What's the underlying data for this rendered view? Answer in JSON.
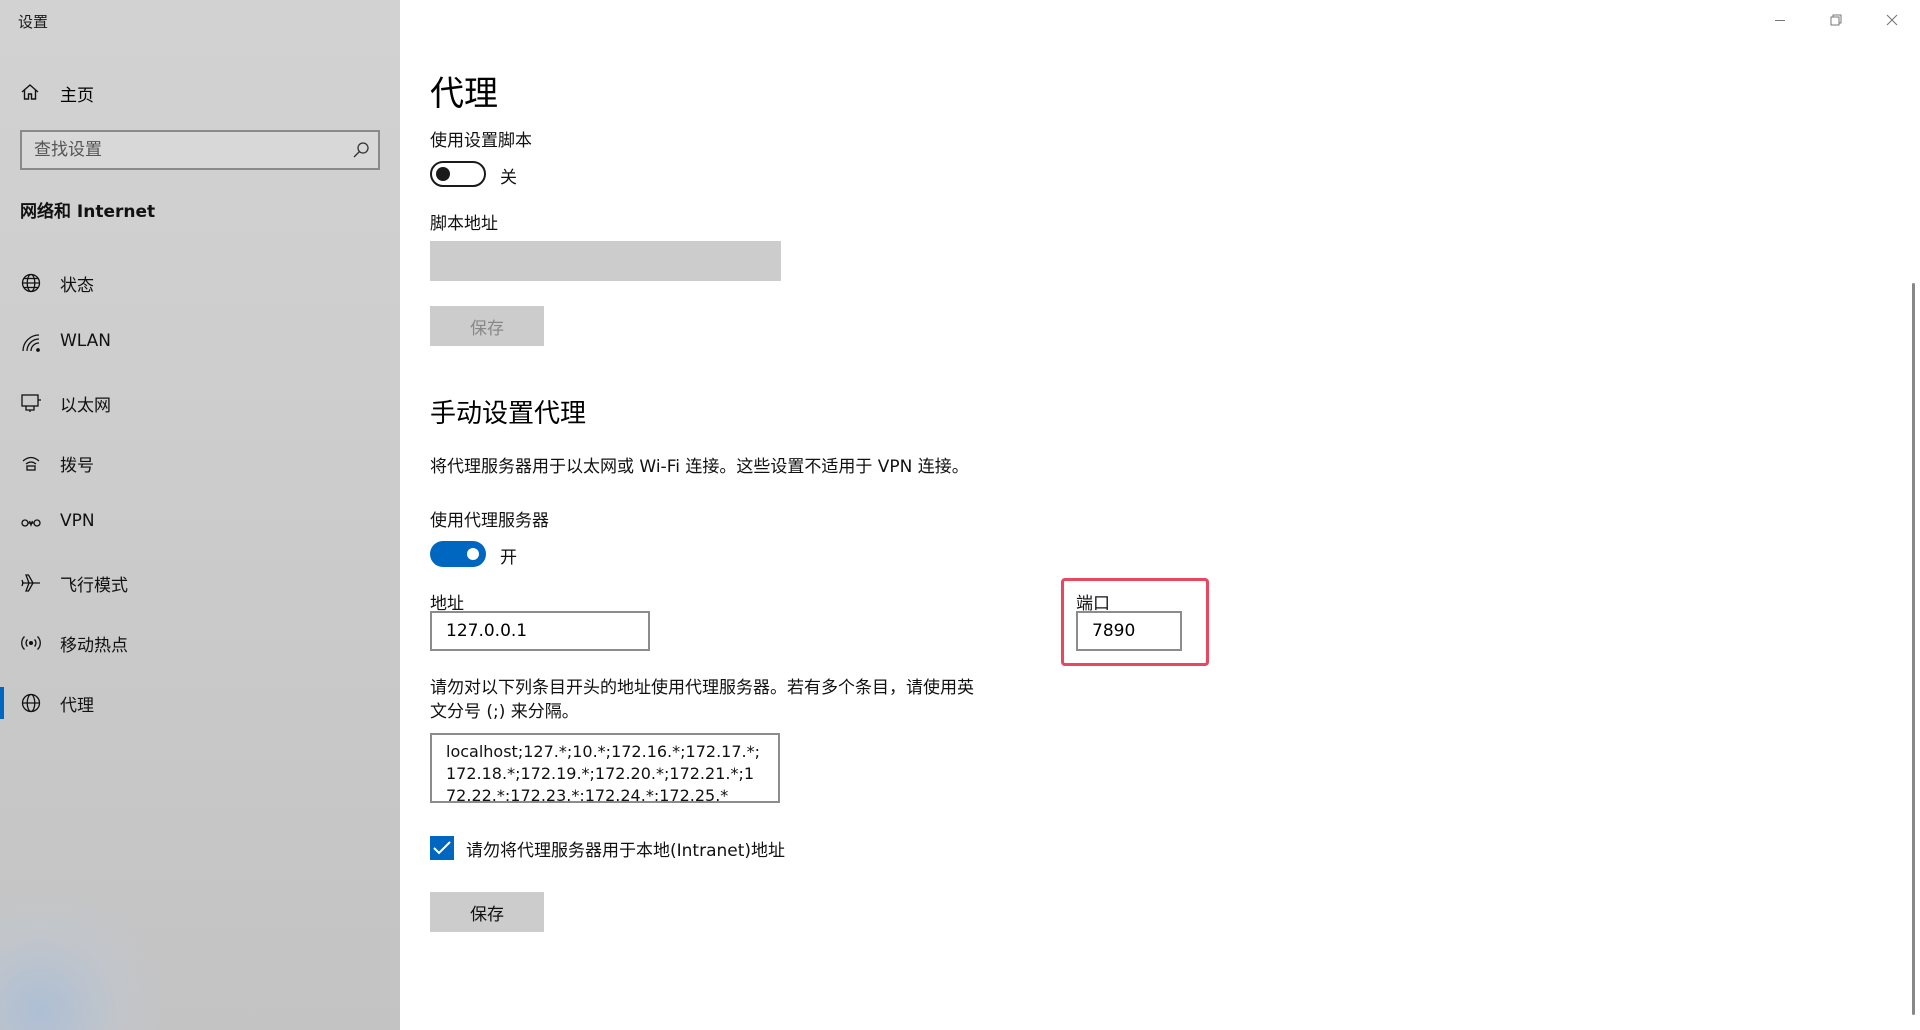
{
  "window": {
    "title": "设置"
  },
  "sidebar": {
    "home_label": "主页",
    "search_placeholder": "查找设置",
    "section_title": "网络和 Internet",
    "items": [
      {
        "label": "状态",
        "icon": "globe-status-icon"
      },
      {
        "label": "WLAN",
        "icon": "wifi-icon"
      },
      {
        "label": "以太网",
        "icon": "ethernet-icon"
      },
      {
        "label": "拨号",
        "icon": "dialup-icon"
      },
      {
        "label": "VPN",
        "icon": "vpn-icon"
      },
      {
        "label": "飞行模式",
        "icon": "airplane-icon"
      },
      {
        "label": "移动热点",
        "icon": "hotspot-icon"
      },
      {
        "label": "代理",
        "icon": "globe-icon",
        "selected": true
      }
    ]
  },
  "main": {
    "title": "代理",
    "script": {
      "toggle_label": "使用设置脚本",
      "toggle_state": "关",
      "toggle_on": false,
      "address_label": "脚本地址",
      "address_value": "",
      "save_label": "保存"
    },
    "manual": {
      "heading": "手动设置代理",
      "description": "将代理服务器用于以太网或 Wi-Fi 连接。这些设置不适用于 VPN 连接。",
      "toggle_label": "使用代理服务器",
      "toggle_state": "开",
      "toggle_on": true,
      "address_label": "地址",
      "address_value": "127.0.0.1",
      "port_label": "端口",
      "port_value": "7890",
      "exceptions_label_line1": "请勿对以下列条目开头的地址使用代理服务器。若有多个条目，请使用英",
      "exceptions_label_line2": "文分号 (;) 来分隔。",
      "exceptions_value": "localhost;127.*;10.*;172.16.*;172.17.*;172.18.*;172.19.*;172.20.*;172.21.*;172.22.*;172.23.*;172.24.*;172.25.*",
      "bypass_local_label": "请勿将代理服务器用于本地(Intranet)地址",
      "bypass_local_checked": true,
      "save_label": "保存"
    }
  },
  "colors": {
    "accent": "#0067c0",
    "highlight": "#e8475f",
    "sidebar_bg": "#cecece"
  }
}
